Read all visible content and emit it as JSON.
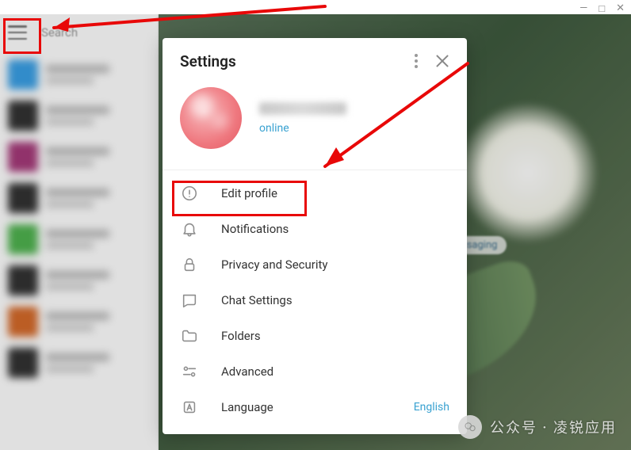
{
  "window": {
    "minimize": "—",
    "maximize": "□",
    "close": "✕"
  },
  "sidebar": {
    "search_placeholder": "Search"
  },
  "bg_message_snippet": "ssaging",
  "settings": {
    "title": "Settings",
    "status": "online",
    "menu": [
      {
        "key": "edit_profile",
        "label": "Edit profile"
      },
      {
        "key": "notifications",
        "label": "Notifications"
      },
      {
        "key": "privacy",
        "label": "Privacy and Security"
      },
      {
        "key": "chat_settings",
        "label": "Chat Settings"
      },
      {
        "key": "folders",
        "label": "Folders"
      },
      {
        "key": "advanced",
        "label": "Advanced"
      },
      {
        "key": "language",
        "label": "Language",
        "right": "English"
      }
    ]
  },
  "watermark": "公众号 · 凌锐应用",
  "chat_avatar_colors": [
    "#3aa0e6",
    "#333333",
    "#a63a7a",
    "#333333",
    "#4fb34f",
    "#333333",
    "#d56a2a",
    "#333333"
  ]
}
